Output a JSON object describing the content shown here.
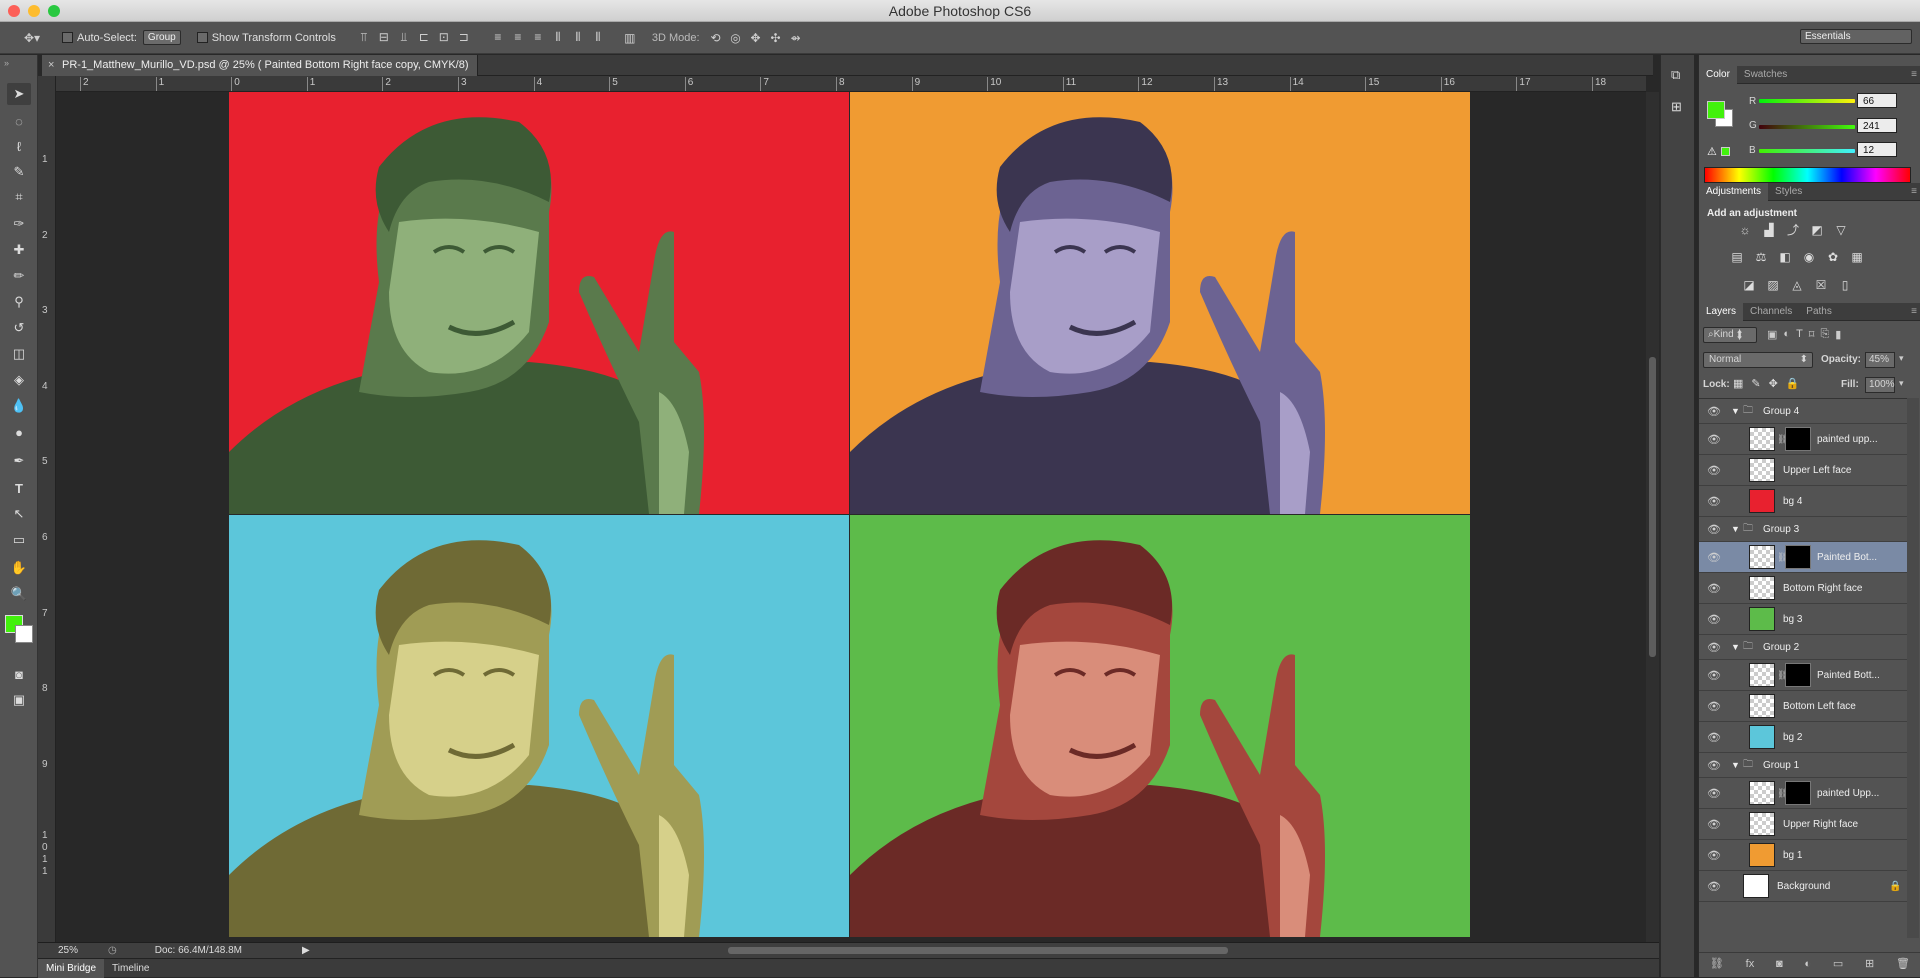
{
  "titlebar": {
    "title": "Adobe Photoshop CS6"
  },
  "options": {
    "auto_select_label": "Auto-Select:",
    "auto_select_value": "Group",
    "transform_label": "Show Transform Controls",
    "mode3d_label": "3D Mode:",
    "workspace": "Essentials"
  },
  "document": {
    "tab_title": "PR-1_Matthew_Murillo_VD.psd @ 25% ( Painted Bottom Right face copy, CMYK/8)"
  },
  "rulers": {
    "top": [
      "2",
      "1",
      "0",
      "1",
      "2",
      "3",
      "4",
      "5",
      "6",
      "7",
      "8",
      "9",
      "10",
      "11",
      "12",
      "13",
      "14",
      "15",
      "16",
      "17",
      "18"
    ],
    "left": [
      "1",
      "2",
      "3",
      "4",
      "5",
      "6",
      "7",
      "8",
      "9",
      "1",
      "0",
      "1",
      "1"
    ]
  },
  "artwork": {
    "quadrants": [
      {
        "bg": "#e8212f",
        "face_dark": "#3d5a35",
        "face_mid": "#5a7a4c",
        "face_light": "#8fb07a"
      },
      {
        "bg": "#f09b32",
        "face_dark": "#3b3550",
        "face_mid": "#6c6392",
        "face_light": "#a89ec8"
      },
      {
        "bg": "#5cc6da",
        "face_dark": "#6f6a35",
        "face_mid": "#a09c55",
        "face_light": "#d6d08a"
      },
      {
        "bg": "#5dbb4a",
        "face_dark": "#6b2a26",
        "face_mid": "#a4473d",
        "face_light": "#d98d7a"
      }
    ]
  },
  "status": {
    "zoom": "25%",
    "doc_size": "Doc: 66.4M/148.8M"
  },
  "bottom_tabs": [
    "Mini Bridge",
    "Timeline"
  ],
  "color_panel": {
    "tabs": [
      "Color",
      "Swatches"
    ],
    "fg": "#42f10c",
    "channels": [
      {
        "label": "R",
        "value": "66"
      },
      {
        "label": "G",
        "value": "241"
      },
      {
        "label": "B",
        "value": "12"
      }
    ]
  },
  "adjustments_panel": {
    "tabs": [
      "Adjustments",
      "Styles"
    ],
    "heading": "Add an adjustment"
  },
  "layers_panel": {
    "tabs": [
      "Layers",
      "Channels",
      "Paths"
    ],
    "filter": "Kind",
    "blend_mode": "Normal",
    "opacity_label": "Opacity:",
    "opacity": "45%",
    "lock_label": "Lock:",
    "fill_label": "Fill:",
    "fill": "100%",
    "layers": [
      {
        "name": "Group 4",
        "type": "group"
      },
      {
        "name": "painted upp...",
        "type": "masked",
        "indent": true,
        "color": "#3d5a35"
      },
      {
        "name": "Upper Left face",
        "type": "layer",
        "indent": true,
        "color": "#555"
      },
      {
        "name": "bg 4",
        "type": "fill",
        "indent": true,
        "color": "#e8212f"
      },
      {
        "name": "Group 3",
        "type": "group"
      },
      {
        "name": "Painted Bot...",
        "type": "masked",
        "indent": true,
        "color": "#a4473d",
        "selected": true
      },
      {
        "name": "Bottom Right face",
        "type": "layer",
        "indent": true,
        "color": "#555"
      },
      {
        "name": "bg 3",
        "type": "fill",
        "indent": true,
        "color": "#5dbb4a"
      },
      {
        "name": "Group 2",
        "type": "group"
      },
      {
        "name": "Painted Bott...",
        "type": "masked",
        "indent": true,
        "color": "#d6d08a"
      },
      {
        "name": "Bottom Left face",
        "type": "layer",
        "indent": true,
        "color": "#555"
      },
      {
        "name": "bg 2",
        "type": "fill",
        "indent": true,
        "color": "#5cc6da"
      },
      {
        "name": "Group 1",
        "type": "group"
      },
      {
        "name": "painted Upp...",
        "type": "masked",
        "indent": true,
        "color": "#6c6392"
      },
      {
        "name": "Upper Right face",
        "type": "layer",
        "indent": true,
        "color": "#555"
      },
      {
        "name": "bg 1",
        "type": "fill",
        "indent": true,
        "color": "#f09b32"
      },
      {
        "name": "Background",
        "type": "background"
      }
    ]
  }
}
